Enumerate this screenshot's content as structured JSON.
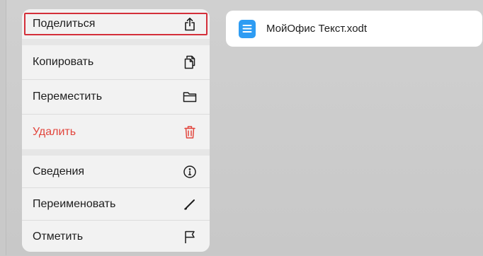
{
  "menu": {
    "groups": [
      {
        "items": [
          {
            "label": "Поделиться",
            "icon": "share-icon"
          }
        ]
      },
      {
        "items": [
          {
            "label": "Копировать",
            "icon": "copy-icon"
          },
          {
            "label": "Переместить",
            "icon": "folder-icon"
          },
          {
            "label": "Удалить",
            "icon": "trash-icon"
          }
        ]
      },
      {
        "items": [
          {
            "label": "Сведения",
            "icon": "info-icon"
          },
          {
            "label": "Переименовать",
            "icon": "pencil-icon"
          },
          {
            "label": "Отметить",
            "icon": "flag-icon"
          }
        ]
      }
    ]
  },
  "file": {
    "name": "МойОфис Текст.xodt",
    "icon": "text-document-icon"
  },
  "colors": {
    "danger": "#e2453c",
    "highlight_border": "#d42f3a",
    "doc_icon_blue": "#2e9cf3"
  }
}
